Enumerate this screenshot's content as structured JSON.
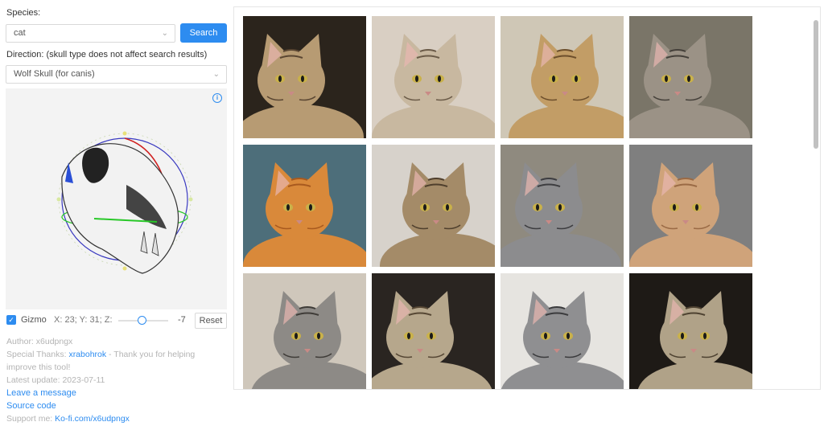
{
  "species": {
    "label": "Species:",
    "value": "cat",
    "search_label": "Search"
  },
  "direction": {
    "label": "Direction: (skull type does not affect search results)",
    "value": "Wolf Skull (for canis)"
  },
  "viewer": {
    "info_icon": "info-icon"
  },
  "controls": {
    "gizmo_label": "Gizmo",
    "gizmo_checked": true,
    "coords": "X: 23; Y: 31; Z:",
    "z_value": "-7",
    "reset_label": "Reset"
  },
  "meta": {
    "author": "Author: x6udpngx",
    "thanks_prefix": "Special Thanks: ",
    "thanks_name": "xrabohrok",
    "thanks_suffix": " - Thank you for helping",
    "thanks_line2": "improve this tool!",
    "latest_update": "Latest update: 2023-07-11",
    "leave_message": "Leave a message",
    "source_code": "Source code",
    "support_prefix": "Support me: ",
    "support_link": "Ko-fi.com/x6udpngx"
  },
  "results": {
    "cats": [
      {
        "bg": "#2b241c",
        "fur": "#b79b73",
        "stripe": "#5a4632"
      },
      {
        "bg": "#d9cfc3",
        "fur": "#c8b8a0",
        "stripe": "#6b5b48"
      },
      {
        "bg": "#cfc7b6",
        "fur": "#c29d66",
        "stripe": "#6d4f2c"
      },
      {
        "bg": "#7a7568",
        "fur": "#9b9286",
        "stripe": "#45403a"
      },
      {
        "bg": "#4d6e7a",
        "fur": "#d9893a",
        "stripe": "#a85a1f"
      },
      {
        "bg": "#d7d2cb",
        "fur": "#a48b68",
        "stripe": "#4f3f2d"
      },
      {
        "bg": "#8f8a7f",
        "fur": "#8c8c8e",
        "stripe": "#3d3d40"
      },
      {
        "bg": "#7f7f7f",
        "fur": "#cfa37a",
        "stripe": "#9a6a45"
      },
      {
        "bg": "#cfc7bb",
        "fur": "#8d8a86",
        "stripe": "#3f3c38"
      },
      {
        "bg": "#2a2521",
        "fur": "#b6a78c",
        "stripe": "#564734"
      },
      {
        "bg": "#e6e4e0",
        "fur": "#8f8f91",
        "stripe": "#3b3b3d"
      },
      {
        "bg": "#1e1a16",
        "fur": "#b0a288",
        "stripe": "#4e4231"
      }
    ]
  }
}
